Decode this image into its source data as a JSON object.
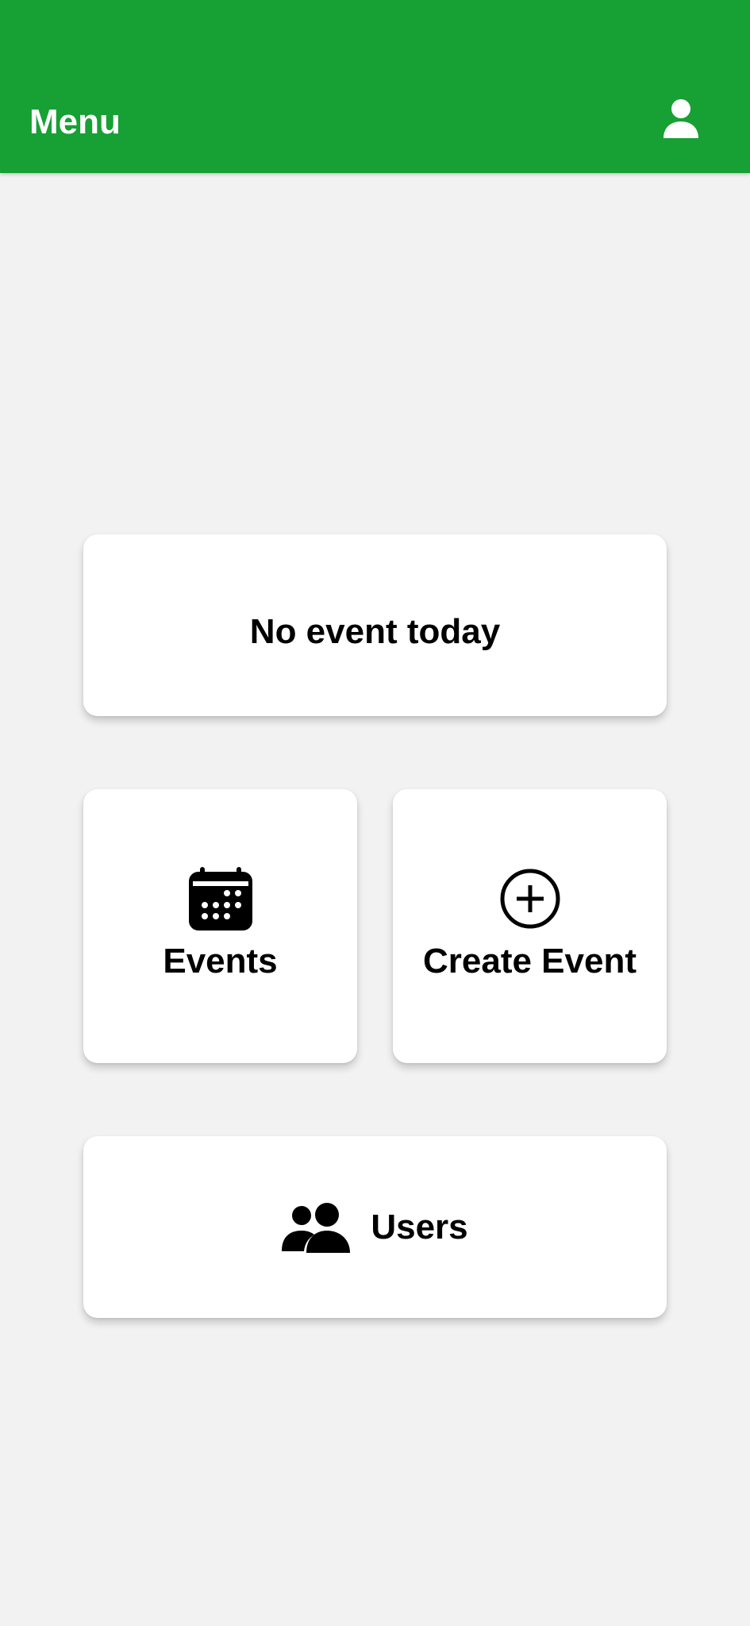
{
  "app_bar": {
    "title": "Menu",
    "profile_icon": "person-icon",
    "color": "#17a034"
  },
  "today_card": {
    "label": "No event today"
  },
  "tiles": [
    {
      "label": "Events",
      "icon": "calendar-icon"
    },
    {
      "label": "Create Event",
      "icon": "add-circle-icon"
    }
  ],
  "users_card": {
    "label": "Users",
    "icon": "users-icon"
  },
  "colors": {
    "background": "#f2f2f2",
    "card": "#ffffff",
    "text": "#000000"
  }
}
